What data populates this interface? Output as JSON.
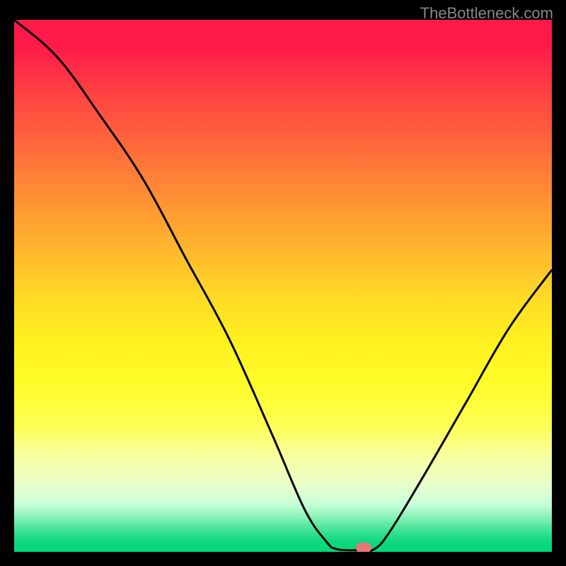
{
  "attribution": "TheBottleneck.com",
  "chart_data": {
    "type": "line",
    "title": "",
    "xlabel": "",
    "ylabel": "",
    "xlim": [
      0,
      100
    ],
    "ylim": [
      0,
      100
    ],
    "curve_percent": [
      {
        "x": 0,
        "y": 100
      },
      {
        "x": 8,
        "y": 93
      },
      {
        "x": 16,
        "y": 82
      },
      {
        "x": 24,
        "y": 70
      },
      {
        "x": 32,
        "y": 55
      },
      {
        "x": 40,
        "y": 40
      },
      {
        "x": 48,
        "y": 22
      },
      {
        "x": 54,
        "y": 8
      },
      {
        "x": 58,
        "y": 2
      },
      {
        "x": 60,
        "y": 0.5
      },
      {
        "x": 64,
        "y": 0.3
      },
      {
        "x": 67,
        "y": 0.5
      },
      {
        "x": 70,
        "y": 4
      },
      {
        "x": 76,
        "y": 14
      },
      {
        "x": 84,
        "y": 28
      },
      {
        "x": 92,
        "y": 42
      },
      {
        "x": 100,
        "y": 53
      }
    ],
    "marker": {
      "x": 65,
      "y": 0.5
    },
    "gradient_stops": [
      {
        "pos": 0,
        "color": "#ff1a4a"
      },
      {
        "pos": 50,
        "color": "#ffda26"
      },
      {
        "pos": 100,
        "color": "#00d878"
      }
    ]
  }
}
